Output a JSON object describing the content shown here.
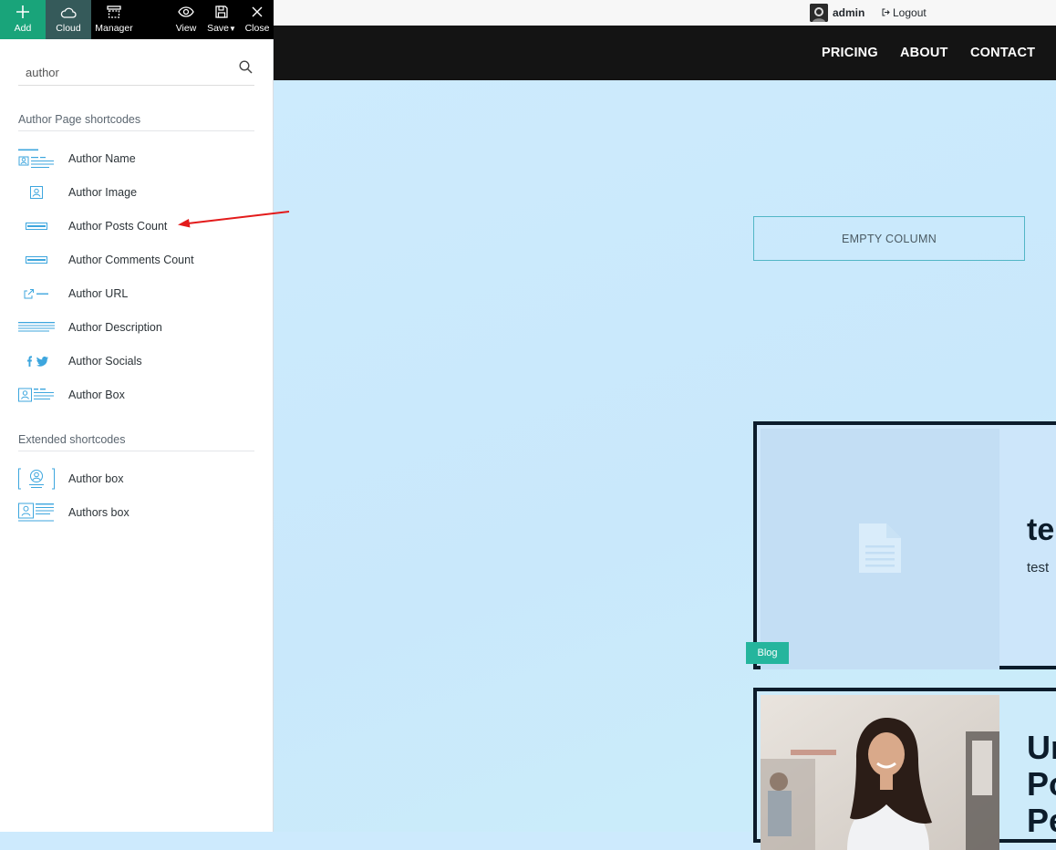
{
  "toolbar": {
    "add": "Add",
    "cloud": "Cloud",
    "manager": "Manager",
    "view": "View",
    "save": "Save",
    "close": "Close"
  },
  "search": {
    "value": "author",
    "icon": "search-icon"
  },
  "sections": [
    {
      "title": "Author Page shortcodes",
      "items": [
        {
          "label": "Author Name",
          "icon": "author-name-icon"
        },
        {
          "label": "Author Image",
          "icon": "author-image-icon"
        },
        {
          "label": "Author Posts Count",
          "icon": "author-posts-count-icon"
        },
        {
          "label": "Author Comments Count",
          "icon": "author-comments-count-icon"
        },
        {
          "label": "Author URL",
          "icon": "author-url-icon"
        },
        {
          "label": "Author Description",
          "icon": "author-description-icon"
        },
        {
          "label": "Author Socials",
          "icon": "author-socials-icon"
        },
        {
          "label": "Author Box",
          "icon": "author-box-icon"
        }
      ]
    },
    {
      "title": "Extended shortcodes",
      "items": [
        {
          "label": "Author box",
          "icon": "author-box-extended-icon"
        },
        {
          "label": "Authors box",
          "icon": "authors-box-icon"
        }
      ]
    }
  ],
  "adminbar": {
    "user": "admin",
    "logout": "Logout"
  },
  "nav": {
    "pricing": "PRICING",
    "about": "ABOUT",
    "contact": "CONTACT"
  },
  "canvas": {
    "empty_column": "EMPTY COLUMN",
    "card1_title": "te",
    "card1_sub": "test",
    "blog_tag": "Blog",
    "card2_title": [
      "Ur",
      "Po",
      "Pe"
    ]
  },
  "colors": {
    "add_bg": "#19a47a",
    "cloud_bg": "#355a5a",
    "icon_blue": "#3da6de",
    "canvas_bg": "#cdeafd",
    "blog_tag": "#25b59d",
    "annotation_arrow": "#e31b1b"
  }
}
